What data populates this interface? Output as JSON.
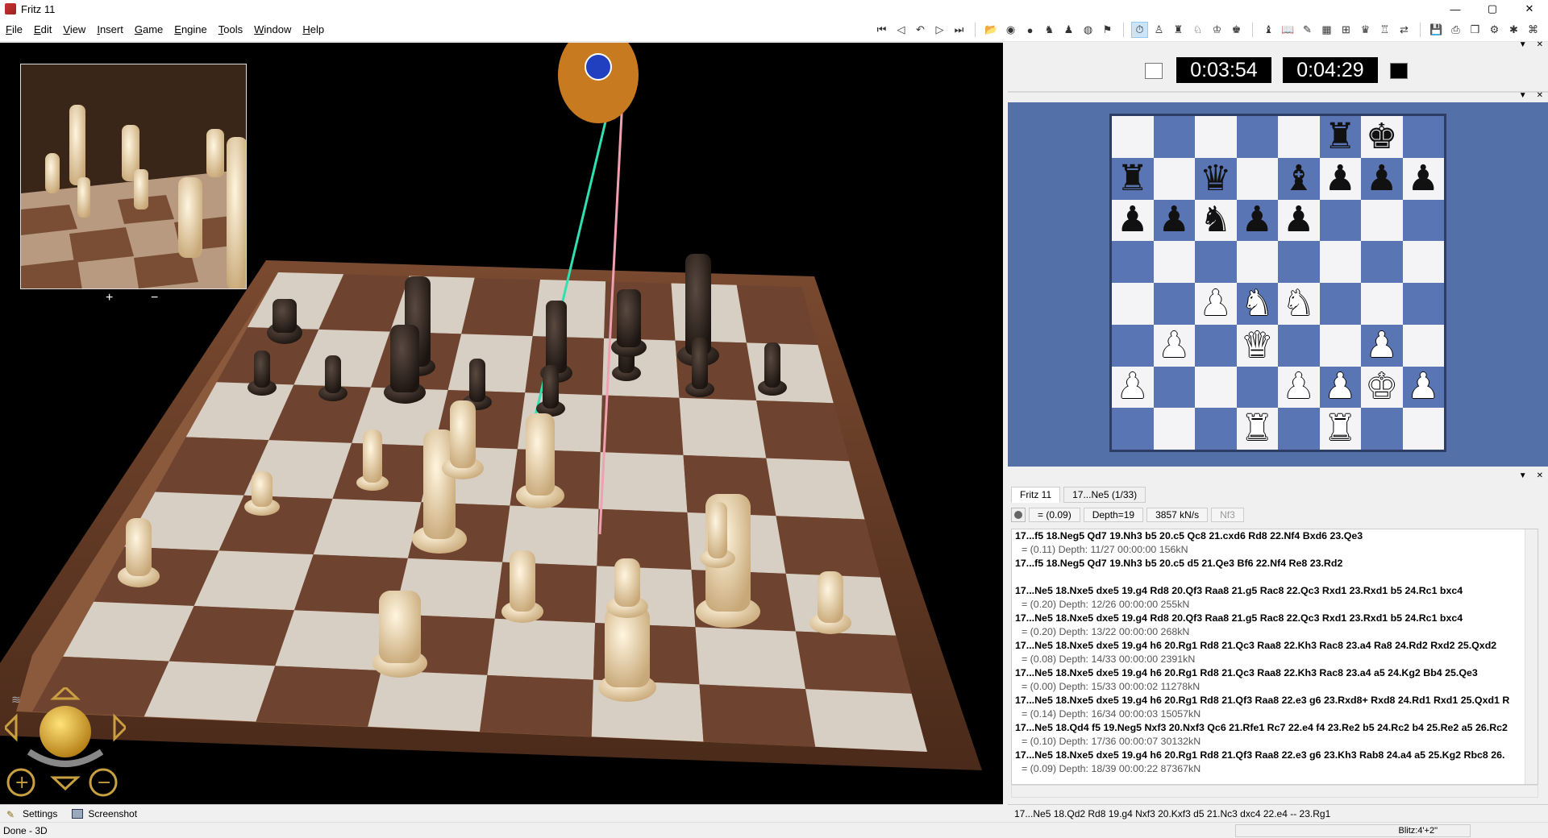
{
  "window": {
    "title": "Fritz 11",
    "min": "—",
    "max": "▢",
    "close": "✕"
  },
  "menu": [
    "File",
    "Edit",
    "View",
    "Insert",
    "Game",
    "Engine",
    "Tools",
    "Window",
    "Help"
  ],
  "toolbar_icons": [
    "first-move",
    "prev-move",
    "take-back",
    "next-move",
    "last-move",
    "open-db",
    "save-game",
    "hint",
    "analyze",
    "new-game",
    "flag",
    "clock",
    "pawn-icon",
    "king-icon",
    "knight-icon",
    "gear-icon",
    "book-icon",
    "board-icon",
    "cup-icon",
    "globe-icon",
    "camera-icon",
    "fonts-icon",
    "diskette-icon",
    "printer-icon",
    "cube-icon",
    "sound-icon",
    "robot-icon"
  ],
  "clock": {
    "white_time": "0:03:54",
    "black_time": "0:04:29"
  },
  "minimap": {
    "plus": "+",
    "minus": "−"
  },
  "board": [
    [
      "",
      "",
      "",
      "",
      "",
      "bR",
      "bK",
      ""
    ],
    [
      "bR",
      "",
      "bQ",
      "",
      "bB",
      "bP",
      "bP",
      "bP"
    ],
    [
      "bP",
      "bP",
      "bN",
      "bP",
      "bP",
      "",
      "",
      ""
    ],
    [
      "",
      "",
      "",
      "",
      "",
      "",
      "",
      ""
    ],
    [
      "",
      "",
      "wP",
      "wN",
      "wN",
      "",
      "",
      ""
    ],
    [
      "",
      "wP",
      "",
      "wQ",
      "",
      "",
      "wP",
      ""
    ],
    [
      "wP",
      "",
      "",
      "",
      "wP",
      "wP",
      "wK",
      "wP"
    ],
    [
      "",
      "",
      "",
      "wR",
      "",
      "wR",
      "",
      ""
    ]
  ],
  "engine": {
    "tabs": [
      "Fritz 11",
      "17...Ne5 (1/33)"
    ],
    "eval": "=  (0.09)",
    "depth": "Depth=19",
    "speed": "3857 kN/s",
    "move": "Nf3",
    "lines": [
      {
        "main": "17...f5 18.Neg5 Qd7 19.Nh3 b5 20.c5 Qc8 21.cxd6 Rd8 22.Nf4 Bxd6 23.Qe3",
        "sub": "=  (0.11)   Depth: 11/27   00:00:00  156kN"
      },
      {
        "main": "17...f5 18.Neg5 Qd7 19.Nh3 b5 20.c5 d5 21.Qe3 Bf6 22.Nf4 Re8 23.Rd2",
        "sub": ""
      },
      {
        "main": "",
        "sub": ""
      },
      {
        "main": "17...Ne5 18.Nxe5 dxe5 19.g4 Rd8 20.Qf3 Raa8 21.g5 Rac8 22.Qc3 Rxd1 23.Rxd1 b5 24.Rc1 bxc4",
        "sub": "=  (0.20)   Depth: 12/26   00:00:00  255kN"
      },
      {
        "main": "17...Ne5 18.Nxe5 dxe5 19.g4 Rd8 20.Qf3 Raa8 21.g5 Rac8 22.Qc3 Rxd1 23.Rxd1 b5 24.Rc1 bxc4",
        "sub": "=  (0.20)   Depth: 13/22   00:00:00  268kN"
      },
      {
        "main": "17...Ne5 18.Nxe5 dxe5 19.g4 h6 20.Rg1 Rd8 21.Qc3 Raa8 22.Kh3 Rac8 23.a4 Ra8 24.Rd2 Rxd2 25.Qxd2",
        "sub": "=  (0.08)   Depth: 14/33   00:00:00  2391kN"
      },
      {
        "main": "17...Ne5 18.Nxe5 dxe5 19.g4 h6 20.Rg1 Rd8 21.Qc3 Raa8 22.Kh3 Rac8 23.a4 a5 24.Kg2 Bb4 25.Qe3",
        "sub": "=  (0.00)   Depth: 15/33   00:00:02  11278kN"
      },
      {
        "main": "17...Ne5 18.Nxe5 dxe5 19.g4 h6 20.Rg1 Rd8 21.Qf3 Raa8 22.e3 g6 23.Rxd8+ Rxd8 24.Rd1 Rxd1 25.Qxd1 R",
        "sub": "=  (0.14)   Depth: 16/34   00:00:03  15057kN"
      },
      {
        "main": "17...Ne5 18.Qd4 f5 19.Neg5 Nxf3 20.Nxf3 Qc6 21.Rfe1 Rc7 22.e4 f4 23.Re2 b5 24.Rc2 b4 25.Re2 a5 26.Rc2",
        "sub": "=  (0.10)   Depth: 17/36   00:00:07  30132kN"
      },
      {
        "main": "17...Ne5 18.Nxe5 dxe5 19.g4 h6 20.Rg1 Rd8 21.Qf3 Raa8 22.e3 g6 23.Kh3 Rab8 24.a4 a5 25.Kg2 Rbc8 26.",
        "sub": "=  (0.09)   Depth: 18/39   00:00:22  87367kN"
      }
    ],
    "bestline": "17...Ne5 18.Qd2 Rd8 19.g4 Nxf3 20.Kxf3 d5 21.Nc3 dxc4 22.e4 -- 23.Rg1"
  },
  "bottom": {
    "settings": "Settings",
    "screenshot": "Screenshot"
  },
  "status": {
    "left": "Done - 3D",
    "right": "Blitz:4'+2\""
  }
}
